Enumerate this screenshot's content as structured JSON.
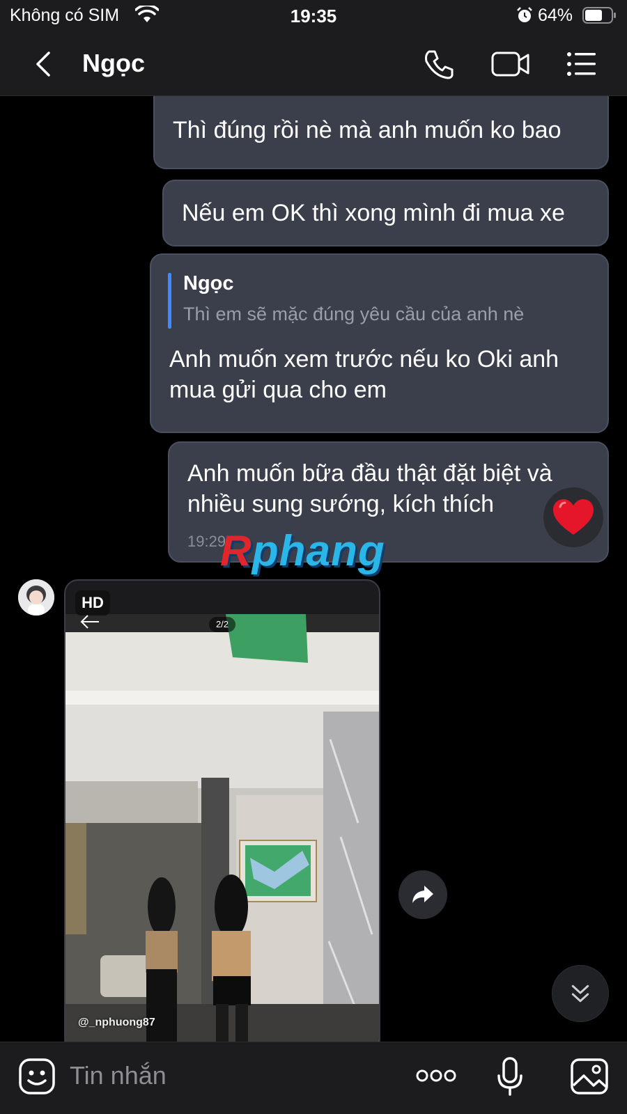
{
  "status_bar": {
    "carrier": "Không có SIM",
    "time": "19:35",
    "battery": "64%",
    "icons": [
      "wifi-icon",
      "alarm-icon",
      "battery-icon"
    ]
  },
  "header": {
    "contact_name": "Ngọc",
    "icons": [
      "back-icon",
      "phone-icon",
      "video-icon",
      "menu-icon"
    ]
  },
  "messages": [
    {
      "text": "Thì đúng rồi nè mà anh muốn ko bao"
    },
    {
      "text": "Nếu em OK thì xong mình đi mua xe"
    },
    {
      "quote": {
        "name": "Ngọc",
        "text": "Thì em sẽ mặc đúng yêu cầu của anh nè"
      },
      "text": "Anh muốn xem trước nếu ko Oki anh mua gửi qua cho em"
    },
    {
      "text": "Anh muốn bữa đầu thật đặt biệt và nhiều sung sướng, kích thích",
      "time": "19:29",
      "reaction": "heart-icon"
    }
  ],
  "watermark": {
    "r": "R",
    "rest": "phang"
  },
  "photo_message": {
    "badge": "HD",
    "counter": "2/2",
    "handle": "@_nphuong87"
  },
  "input_bar": {
    "placeholder": "Tin nhắn",
    "icons": [
      "sticker-icon",
      "more-icon",
      "mic-icon",
      "gallery-icon"
    ]
  },
  "colors": {
    "bubble": "#3a3f4b",
    "quote_accent": "#3d8bff",
    "background": "#000000",
    "bar": "#1c1c1e"
  }
}
